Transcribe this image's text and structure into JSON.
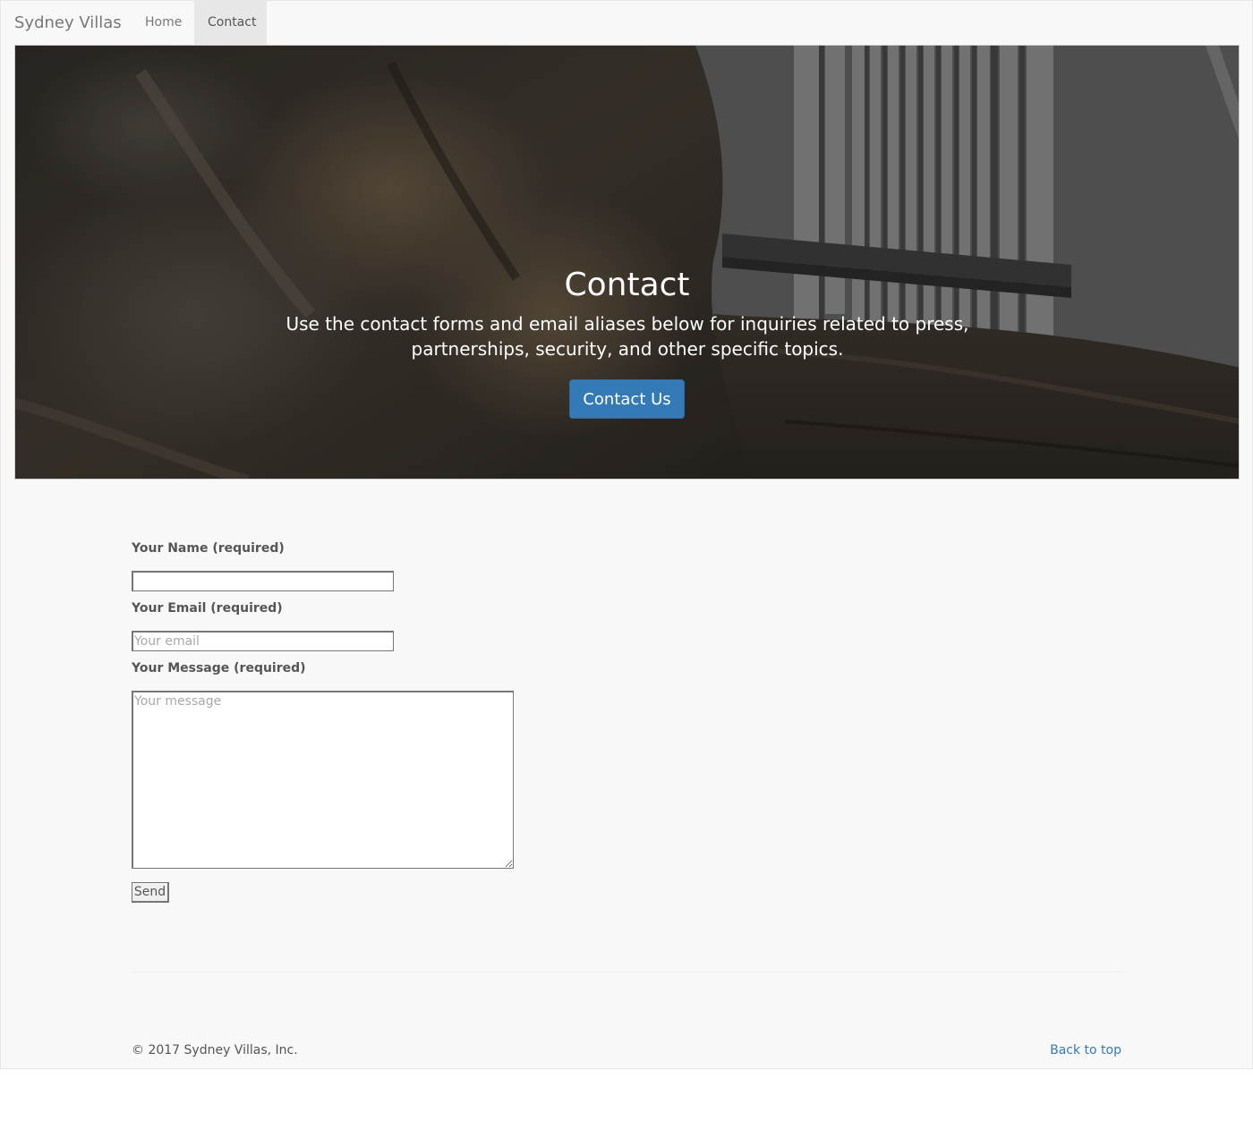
{
  "navbar": {
    "brand": "Sydney Villas",
    "items": [
      {
        "label": "Home",
        "active": false
      },
      {
        "label": "Contact",
        "active": true
      }
    ]
  },
  "hero": {
    "title": "Contact",
    "text": "Use the contact forms and email aliases below for inquiries related to press, partnerships, security, and other specific topics.",
    "button_label": "Contact Us",
    "button_color": "#337ab7"
  },
  "form": {
    "name": {
      "label": "Your Name (required)",
      "value": "",
      "placeholder": ""
    },
    "email": {
      "label": "Your Email (required)",
      "value": "",
      "placeholder": "Your email"
    },
    "message": {
      "label": "Your Message (required)",
      "value": "",
      "placeholder": "Your message"
    },
    "submit_label": "Send"
  },
  "footer": {
    "copyright": "© 2017 Sydney Villas, Inc.",
    "back_to_top": "Back to top",
    "link_color": "#337ab7"
  }
}
